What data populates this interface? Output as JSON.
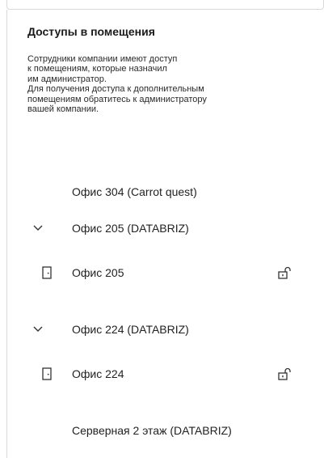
{
  "section": {
    "title": "Доступы в помещения",
    "description": "Сотрудники компании имеют доступ\nк помещениям, которые назначил\nим администратор.\nДля получения доступа к дополнительным\nпомещениям обратитесь к администратору\nвашей компании."
  },
  "rooms": {
    "item0": {
      "label": "Офис 304 (Carrot quest)"
    },
    "group1": {
      "label": "Офис 205 (DATABRIZ)",
      "expanded": true
    },
    "room1": {
      "label": "Офис 205",
      "icon": "door-icon",
      "action_icon": "unlock-icon"
    },
    "group2": {
      "label": "Офис 224 (DATABRIZ)",
      "expanded": true
    },
    "room2": {
      "label": "Офис 224",
      "icon": "door-icon",
      "action_icon": "unlock-icon"
    },
    "item3": {
      "label": "Серверная 2 этаж (DATABRIZ)"
    }
  },
  "colors": {
    "text": "#222222",
    "icon": "#333333",
    "border": "#d9d9d9"
  }
}
